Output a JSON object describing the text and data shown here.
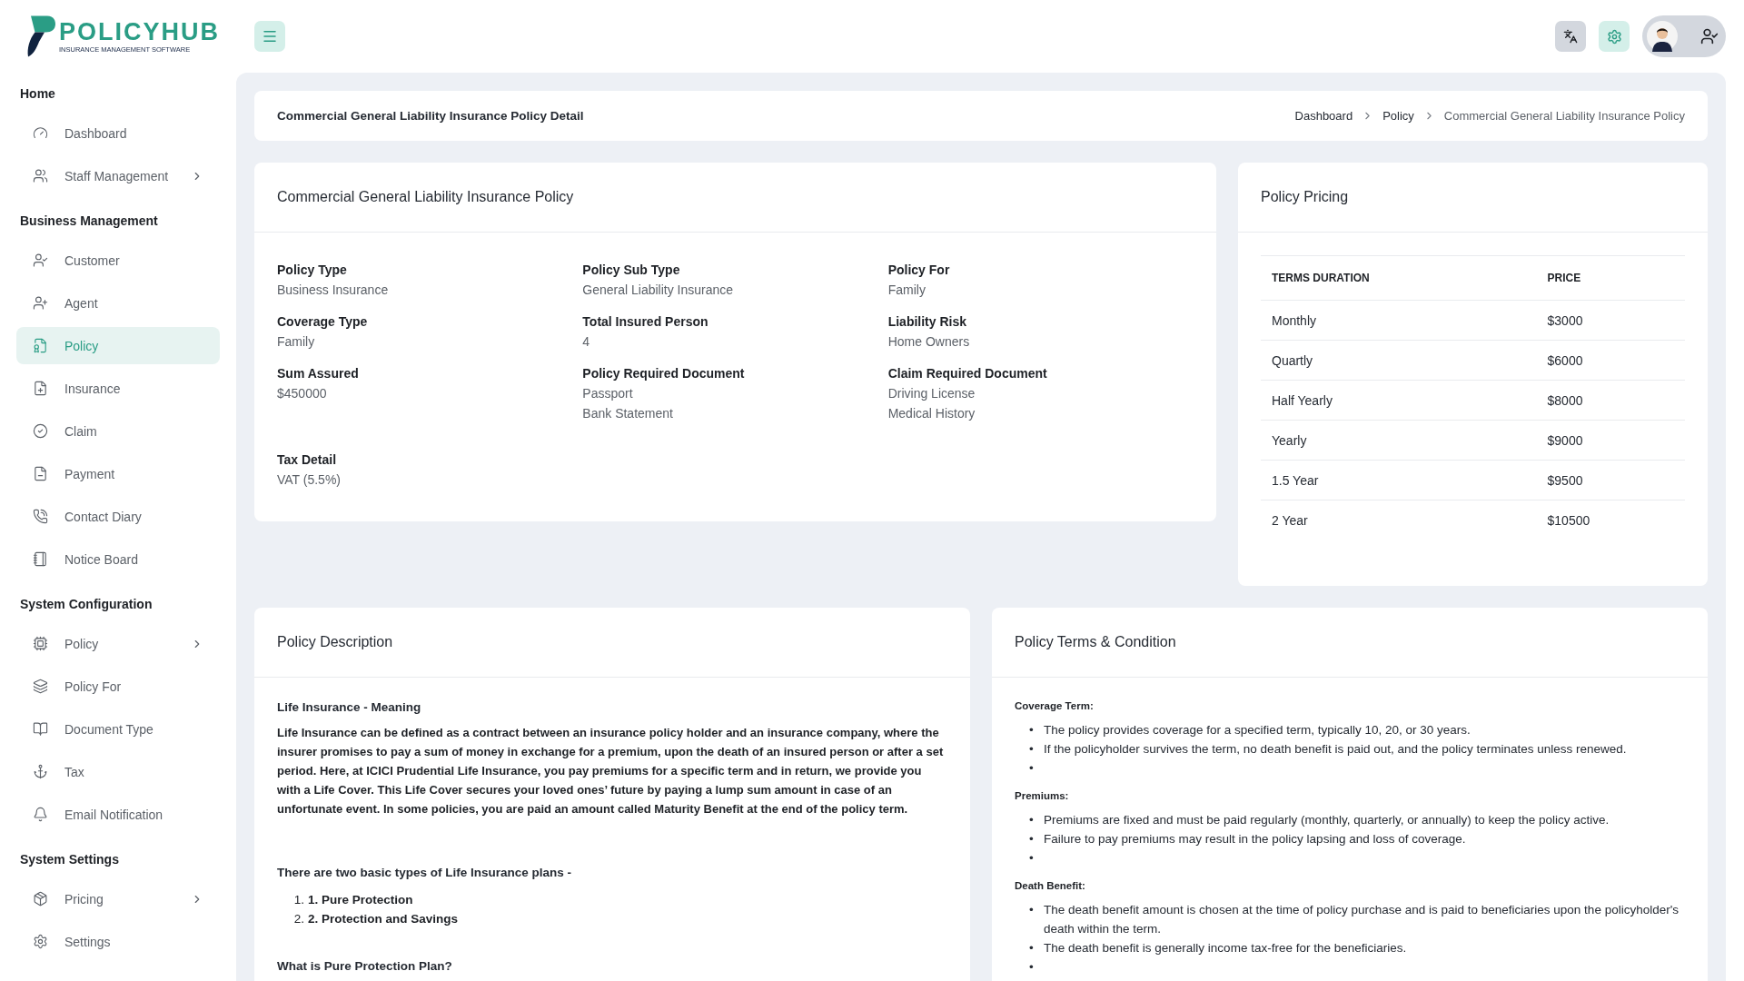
{
  "brand": {
    "name": "POLICYHUB",
    "tagline": "INSURANCE MANAGEMENT SOFTWARE"
  },
  "sidebar": {
    "sections": [
      {
        "title": "Home",
        "items": [
          {
            "label": "Dashboard",
            "selected": false,
            "has_submenu": false
          },
          {
            "label": "Staff Management",
            "selected": false,
            "has_submenu": true
          }
        ]
      },
      {
        "title": "Business Management",
        "items": [
          {
            "label": "Customer",
            "selected": false,
            "has_submenu": false
          },
          {
            "label": "Agent",
            "selected": false,
            "has_submenu": false
          },
          {
            "label": "Policy",
            "selected": true,
            "has_submenu": false
          },
          {
            "label": "Insurance",
            "selected": false,
            "has_submenu": false
          },
          {
            "label": "Claim",
            "selected": false,
            "has_submenu": false
          },
          {
            "label": "Payment",
            "selected": false,
            "has_submenu": false
          },
          {
            "label": "Contact Diary",
            "selected": false,
            "has_submenu": false
          },
          {
            "label": "Notice Board",
            "selected": false,
            "has_submenu": false
          }
        ]
      },
      {
        "title": "System Configuration",
        "items": [
          {
            "label": "Policy",
            "selected": false,
            "has_submenu": true
          },
          {
            "label": "Policy For",
            "selected": false,
            "has_submenu": false
          },
          {
            "label": "Document Type",
            "selected": false,
            "has_submenu": false
          },
          {
            "label": "Tax",
            "selected": false,
            "has_submenu": false
          },
          {
            "label": "Email Notification",
            "selected": false,
            "has_submenu": false
          }
        ]
      },
      {
        "title": "System Settings",
        "items": [
          {
            "label": "Pricing",
            "selected": false,
            "has_submenu": true
          },
          {
            "label": "Settings",
            "selected": false,
            "has_submenu": false
          }
        ]
      }
    ]
  },
  "page_header": {
    "title": "Commercial General Liability Insurance Policy Detail",
    "breadcrumb": [
      "Dashboard",
      "Policy",
      "Commercial General Liability Insurance Policy"
    ]
  },
  "policy_card": {
    "title": "Commercial General Liability Insurance Policy",
    "fields": [
      {
        "label": "Policy Type",
        "values": [
          "Business Insurance"
        ]
      },
      {
        "label": "Policy Sub Type",
        "values": [
          "General Liability Insurance"
        ]
      },
      {
        "label": "Policy For",
        "values": [
          "Family"
        ]
      },
      {
        "label": "Coverage Type",
        "values": [
          "Family"
        ]
      },
      {
        "label": "Total Insured Person",
        "values": [
          "4"
        ]
      },
      {
        "label": "Liability Risk",
        "values": [
          "Home Owners"
        ]
      },
      {
        "label": "Sum Assured",
        "values": [
          "$450000"
        ]
      },
      {
        "label": "Policy Required Document",
        "values": [
          "Passport",
          "Bank Statement"
        ]
      },
      {
        "label": "Claim Required Document",
        "values": [
          "Driving License",
          "Medical History"
        ]
      },
      {
        "label": "Tax Detail",
        "values": [
          "VAT (5.5%)"
        ]
      }
    ]
  },
  "pricing_card": {
    "title": "Policy Pricing",
    "columns": [
      "TERMS DURATION",
      "PRICE"
    ],
    "rows": [
      [
        "Monthly",
        "$3000"
      ],
      [
        "Quartly",
        "$6000"
      ],
      [
        "Half Yearly",
        "$8000"
      ],
      [
        "Yearly",
        "$9000"
      ],
      [
        "1.5 Year",
        "$9500"
      ],
      [
        "2 Year",
        "$10500"
      ]
    ]
  },
  "description_card": {
    "title": "Policy Description",
    "heading": "Life Insurance - Meaning",
    "paragraph": "Life Insurance can be defined as a contract between an insurance policy holder and an insurance company, where the insurer promises to pay a sum of money in exchange for a premium, upon the death of an insured person or after a set period. Here, at ICICI Prudential Life Insurance, you pay premiums for a specific term and in return, we provide you with a Life Cover. This Life Cover secures your loved ones’ future by paying a lump sum amount in case of an unfortunate event. In some policies, you are paid an amount called Maturity Benefit at the end of the policy term.",
    "types_intro": "There are two basic types of Life Insurance plans -",
    "types": [
      {
        "marker": "1.",
        "text": "1. Pure Protection"
      },
      {
        "marker": "2.",
        "text": "2. Protection and Savings"
      }
    ],
    "next_heading": "What is Pure Protection Plan?"
  },
  "terms_card": {
    "title": "Policy Terms & Condition",
    "bullet": "•",
    "sections": [
      {
        "heading": "Coverage Term:",
        "items": [
          "The policy provides coverage for a specified term, typically 10, 20, or 30 years.",
          "If the policyholder survives the term, no death benefit is paid out, and the policy terminates unless renewed."
        ],
        "empty_bullet": true
      },
      {
        "heading": "Premiums:",
        "items": [
          "Premiums are fixed and must be paid regularly (monthly, quarterly, or annually) to keep the policy active.",
          "Failure to pay premiums may result in the policy lapsing and loss of coverage."
        ],
        "empty_bullet": true
      },
      {
        "heading": "Death Benefit:",
        "items": [
          "The death benefit amount is chosen at the time of policy purchase and is paid to beneficiaries upon the policyholder's death within the term.",
          "The death benefit is generally income tax-free for the beneficiaries."
        ],
        "empty_bullet": true
      }
    ]
  }
}
